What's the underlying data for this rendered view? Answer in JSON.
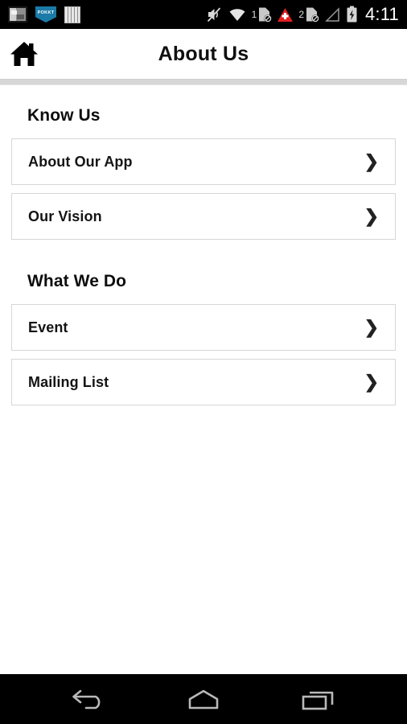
{
  "status_bar": {
    "background": "#000000",
    "left_icons": [
      {
        "name": "screenshot-notification-icon",
        "label": "screenshot"
      },
      {
        "name": "pokkt-notification-icon",
        "label": "POKKT"
      },
      {
        "name": "equalizer-bars-icon",
        "label": "bars"
      }
    ],
    "right_icons": [
      {
        "name": "volume-mute-icon",
        "label": "muted"
      },
      {
        "name": "wifi-icon",
        "label": "wifi"
      },
      {
        "name": "sim1-disabled-icon",
        "label": "1"
      },
      {
        "name": "alert-triangle-icon",
        "label": "alert"
      },
      {
        "name": "sim2-disabled-icon",
        "label": "2"
      },
      {
        "name": "cellular-signal-icon",
        "label": "signal"
      },
      {
        "name": "battery-charging-icon",
        "label": "charging"
      }
    ],
    "sim1_number": "1",
    "sim2_number": "2",
    "clock": "4:11"
  },
  "app_bar": {
    "home_icon": "home-icon",
    "title": "About Us",
    "background": "#ffffff",
    "title_color": "#101010"
  },
  "content": {
    "background": "#ffffff",
    "sections": [
      {
        "title": "Know Us",
        "items": [
          {
            "label": "About Our App",
            "chevron": "❯"
          },
          {
            "label": "Our Vision",
            "chevron": "❯"
          }
        ]
      },
      {
        "title": "What We Do",
        "items": [
          {
            "label": "Event",
            "chevron": "❯"
          },
          {
            "label": "Mailing List",
            "chevron": "❯"
          }
        ]
      }
    ]
  },
  "nav_bar": {
    "background": "#000000",
    "buttons": [
      {
        "name": "back-button",
        "label": "Back"
      },
      {
        "name": "home-button",
        "label": "Home"
      },
      {
        "name": "recent-apps-button",
        "label": "Recent apps"
      }
    ]
  }
}
